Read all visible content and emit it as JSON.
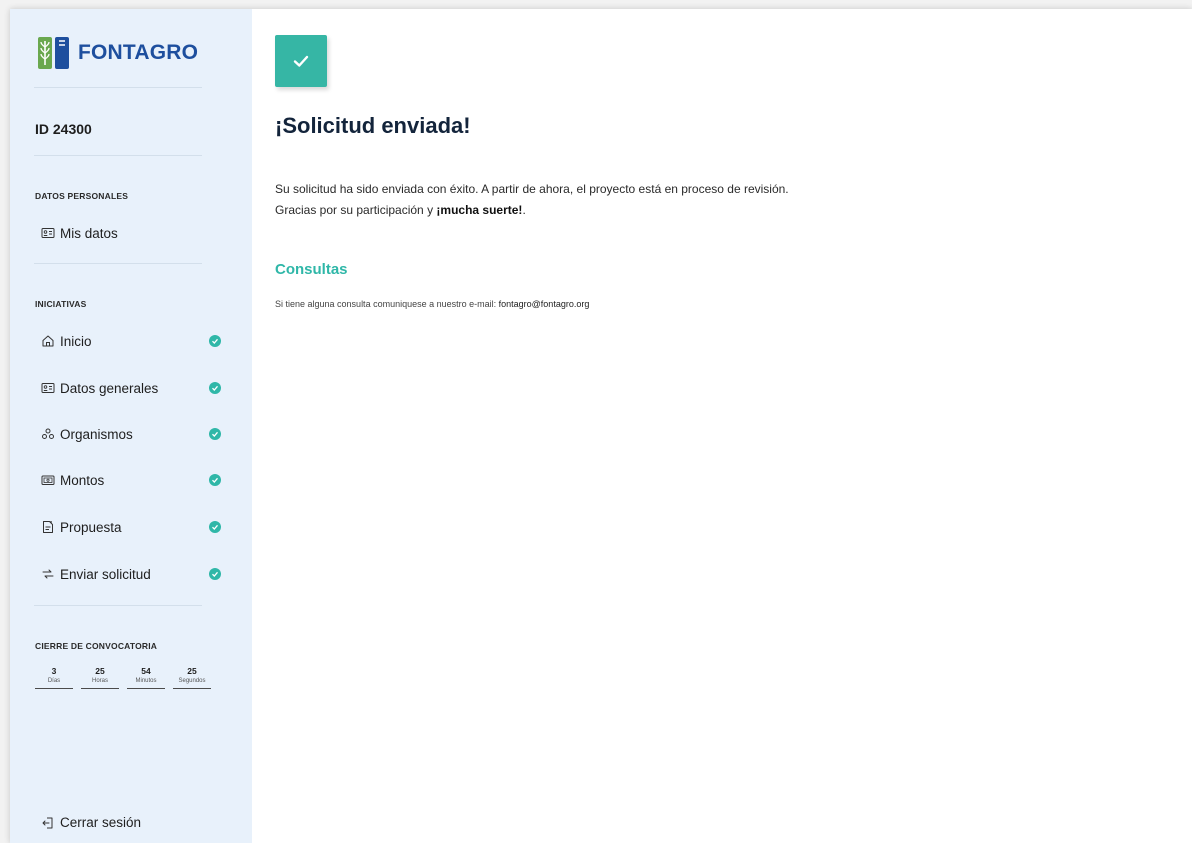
{
  "brand": {
    "name": "FONTAGRO"
  },
  "sidebar": {
    "project_id": "ID 24300",
    "sections": {
      "personal": "DATOS PERSONALES",
      "initiatives": "INICIATIVAS",
      "closing": "CIERRE DE CONVOCATORIA"
    },
    "personal_items": [
      {
        "label": "Mis datos",
        "icon": "id-card-icon"
      }
    ],
    "initiative_items": [
      {
        "label": "Inicio",
        "icon": "home-icon",
        "completed": true
      },
      {
        "label": "Datos generales",
        "icon": "id-card-icon",
        "completed": true
      },
      {
        "label": "Organismos",
        "icon": "organization-icon",
        "completed": true
      },
      {
        "label": "Montos",
        "icon": "money-icon",
        "completed": true
      },
      {
        "label": "Propuesta",
        "icon": "document-icon",
        "completed": true
      },
      {
        "label": "Enviar solicitud",
        "icon": "send-icon",
        "completed": true
      }
    ],
    "countdown": [
      {
        "value": "3",
        "label": "Días"
      },
      {
        "value": "25",
        "label": "Horas"
      },
      {
        "value": "54",
        "label": "Minutos"
      },
      {
        "value": "25",
        "label": "Segundos"
      }
    ],
    "logout_label": "Cerrar sesión"
  },
  "main": {
    "title": "¡Solicitud enviada!",
    "message_line1": "Su solicitud ha sido enviada con éxito. A partir de ahora, el proyecto está en proceso de revisión.",
    "message_line2_prefix": "Gracias por su participación y ",
    "message_line2_bold": "¡mucha suerte!",
    "message_line2_suffix": ".",
    "consultas_title": "Consultas",
    "contact_prefix": "Si tiene alguna consulta comuniquese a nuestro e-mail: ",
    "contact_email": "fontagro@fontagro.org"
  },
  "colors": {
    "sidebar_bg": "#e8f1fb",
    "accent_teal": "#2fb7a8",
    "brand_blue": "#1e4f9e",
    "brand_green": "#6aa84f"
  }
}
